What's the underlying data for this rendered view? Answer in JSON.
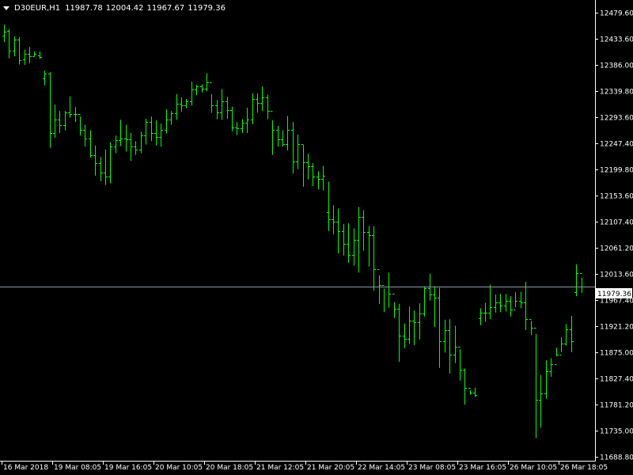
{
  "header": {
    "symbol": "D30EUR,H1",
    "open": "11987.78",
    "high": "12004.42",
    "low": "11967.67",
    "close": "11979.36"
  },
  "colors": {
    "background": "#000000",
    "bars": "#00ff00",
    "axis": "#ffffff",
    "price_line": "#8c9ba8",
    "price_tag_bg": "#ffffff",
    "price_tag_text": "#000000"
  },
  "chart_data": {
    "type": "ohlc",
    "symbol": "D30EUR",
    "timeframe": "H1",
    "ylim": [
      11668.8,
      12479.6
    ],
    "y_ticks": [
      "12479.60",
      "12433.60",
      "12386.00",
      "12339.80",
      "12293.60",
      "12247.40",
      "12199.80",
      "12153.60",
      "12107.40",
      "12061.20",
      "12013.60",
      "11967.40",
      "11921.20",
      "11875.00",
      "11827.40",
      "11781.20",
      "11735.00",
      "11688.80"
    ],
    "x_ticks": [
      "16 Mar 2018",
      "19 Mar 08:05",
      "19 Mar 16:05",
      "20 Mar 10:05",
      "20 Mar 18:05",
      "21 Mar 12:05",
      "21 Mar 20:05",
      "22 Mar 14:05",
      "23 Mar 08:05",
      "23 Mar 16:05",
      "26 Mar 10:05",
      "26 Mar 18:05"
    ],
    "current_price": 11979.36,
    "grid": false,
    "bars": [
      [
        12437,
        12458,
        12426,
        12445
      ],
      [
        12446,
        12450,
        12396,
        12410
      ],
      [
        12410,
        12436,
        12400,
        12430
      ],
      [
        12430,
        12435,
        12385,
        12393
      ],
      [
        12394,
        12412,
        12384,
        12404
      ],
      [
        12404,
        12417,
        12387,
        12400
      ],
      [
        12400,
        12409,
        12400,
        12404
      ],
      [
        12402,
        12409,
        12395,
        12398
      ],
      [
        12360,
        12374,
        12347,
        12369
      ],
      [
        12368,
        12371,
        12233,
        12260
      ],
      [
        12260,
        12312,
        12251,
        12285
      ],
      [
        12285,
        12300,
        12260,
        12274
      ],
      [
        12274,
        12300,
        12265,
        12298
      ],
      [
        12298,
        12327,
        12288,
        12295
      ],
      [
        12295,
        12307,
        12280,
        12294
      ],
      [
        12294,
        12290,
        12255,
        12266
      ],
      [
        12266,
        12275,
        12235,
        12250
      ],
      [
        12250,
        12265,
        12215,
        12220
      ],
      [
        12220,
        12237,
        12182,
        12205
      ],
      [
        12205,
        12216,
        12172,
        12188
      ],
      [
        12188,
        12230,
        12165,
        12181
      ],
      [
        12181,
        12243,
        12168,
        12235
      ],
      [
        12235,
        12255,
        12223,
        12247
      ],
      [
        12247,
        12284,
        12236,
        12250
      ],
      [
        12250,
        12275,
        12226,
        12249
      ],
      [
        12249,
        12260,
        12209,
        12235
      ],
      [
        12235,
        12245,
        12220,
        12230
      ],
      [
        12230,
        12262,
        12223,
        12255
      ],
      [
        12255,
        12286,
        12239,
        12280
      ],
      [
        12280,
        12290,
        12245,
        12260
      ],
      [
        12260,
        12283,
        12237,
        12253
      ],
      [
        12253,
        12277,
        12235,
        12265
      ],
      [
        12265,
        12303,
        12259,
        12285
      ],
      [
        12285,
        12300,
        12275,
        12296
      ],
      [
        12296,
        12331,
        12284,
        12313
      ],
      [
        12313,
        12325,
        12299,
        12310
      ],
      [
        12310,
        12322,
        12305,
        12318
      ],
      [
        12318,
        12354,
        12310,
        12339
      ],
      [
        12339,
        12348,
        12329,
        12345
      ],
      [
        12345,
        12349,
        12334,
        12341
      ],
      [
        12341,
        12369,
        12336,
        12352
      ],
      [
        12352,
        12331,
        12297,
        12310
      ],
      [
        12310,
        12320,
        12285,
        12297
      ],
      [
        12297,
        12340,
        12284,
        12318
      ],
      [
        12318,
        12326,
        12286,
        12302
      ],
      [
        12302,
        12308,
        12263,
        12270
      ],
      [
        12270,
        12280,
        12256,
        12268
      ],
      [
        12268,
        12285,
        12260,
        12279
      ],
      [
        12279,
        12306,
        12260,
        12285
      ],
      [
        12285,
        12332,
        12276,
        12322
      ],
      [
        12322,
        12332,
        12297,
        12315
      ],
      [
        12315,
        12345,
        12300,
        12325
      ],
      [
        12325,
        12330,
        12285,
        12300
      ],
      [
        12300,
        12283,
        12220,
        12265
      ],
      [
        12265,
        12273,
        12235,
        12249
      ],
      [
        12249,
        12265,
        12235,
        12240
      ],
      [
        12240,
        12291,
        12228,
        12265
      ],
      [
        12265,
        12280,
        12186,
        12208
      ],
      [
        12208,
        12257,
        12194,
        12240
      ],
      [
        12240,
        12238,
        12162,
        12206
      ],
      [
        12206,
        12222,
        12175,
        12199
      ],
      [
        12199,
        12205,
        12163,
        12180
      ],
      [
        12180,
        12190,
        12157,
        12176
      ],
      [
        12176,
        12200,
        12155,
        12182
      ],
      [
        12115,
        12171,
        12081,
        12103
      ],
      [
        12103,
        12128,
        12075,
        12098
      ],
      [
        12098,
        12122,
        12040,
        12081
      ],
      [
        12081,
        12094,
        12036,
        12057
      ],
      [
        12057,
        12095,
        12023,
        12037
      ],
      [
        12037,
        12086,
        12018,
        12065
      ],
      [
        12065,
        12125,
        12005,
        12107
      ],
      [
        12107,
        12119,
        12045,
        12079
      ],
      [
        12079,
        12090,
        12016,
        12074
      ],
      [
        12074,
        12090,
        11972,
        12012
      ],
      [
        12012,
        12000,
        11948,
        11982
      ],
      [
        11982,
        11976,
        11933,
        11980
      ],
      [
        11980,
        12005,
        11941,
        11967
      ],
      [
        11967,
        11951,
        11922,
        11939
      ],
      [
        11939,
        11948,
        11842,
        11890
      ],
      [
        11890,
        11912,
        11867,
        11884
      ],
      [
        11884,
        11943,
        11875,
        11918
      ],
      [
        11918,
        11936,
        11873,
        11915
      ],
      [
        11915,
        11949,
        11883,
        11930
      ],
      [
        11930,
        11980,
        11925,
        11976
      ],
      [
        11976,
        12003,
        11954,
        11965
      ],
      [
        11965,
        11980,
        11906,
        11959
      ],
      [
        11959,
        11977,
        11831,
        11880
      ],
      [
        11880,
        11919,
        11859,
        11900
      ],
      [
        11900,
        11920,
        11821,
        11855
      ],
      [
        11855,
        11908,
        11840,
        11869
      ],
      [
        11869,
        11865,
        11808,
        11828
      ],
      [
        11828,
        11830,
        11764,
        11795
      ],
      [
        11795,
        11790,
        11782,
        11786
      ],
      [
        11786,
        11795,
        11778,
        11782
      ],
      [
        11922,
        11940,
        11909,
        11932
      ],
      [
        11932,
        11950,
        11915,
        11932
      ],
      [
        11932,
        11983,
        11920,
        11942
      ],
      [
        11942,
        11965,
        11932,
        11950
      ],
      [
        11950,
        11966,
        11933,
        11945
      ],
      [
        11945,
        11966,
        11934,
        11953
      ],
      [
        11953,
        11962,
        11925,
        11937
      ],
      [
        11937,
        11969,
        11942,
        11954
      ],
      [
        11954,
        11970,
        11940,
        11950
      ],
      [
        11950,
        11988,
        11900,
        11920
      ],
      [
        11920,
        11917,
        11891,
        11905
      ],
      [
        11905,
        11893,
        11703,
        11773
      ],
      [
        11773,
        11818,
        11722,
        11785
      ],
      [
        11785,
        11845,
        11775,
        11825
      ],
      [
        11825,
        11849,
        11815,
        11838
      ],
      [
        11838,
        11868,
        11852,
        11855
      ],
      [
        11855,
        11887,
        11860,
        11876
      ],
      [
        11876,
        11911,
        11872,
        11902
      ],
      [
        11902,
        11926,
        11860,
        11880
      ],
      [
        11970,
        12020,
        11962,
        12004
      ],
      [
        12004,
        11996,
        11968,
        11979
      ]
    ]
  }
}
